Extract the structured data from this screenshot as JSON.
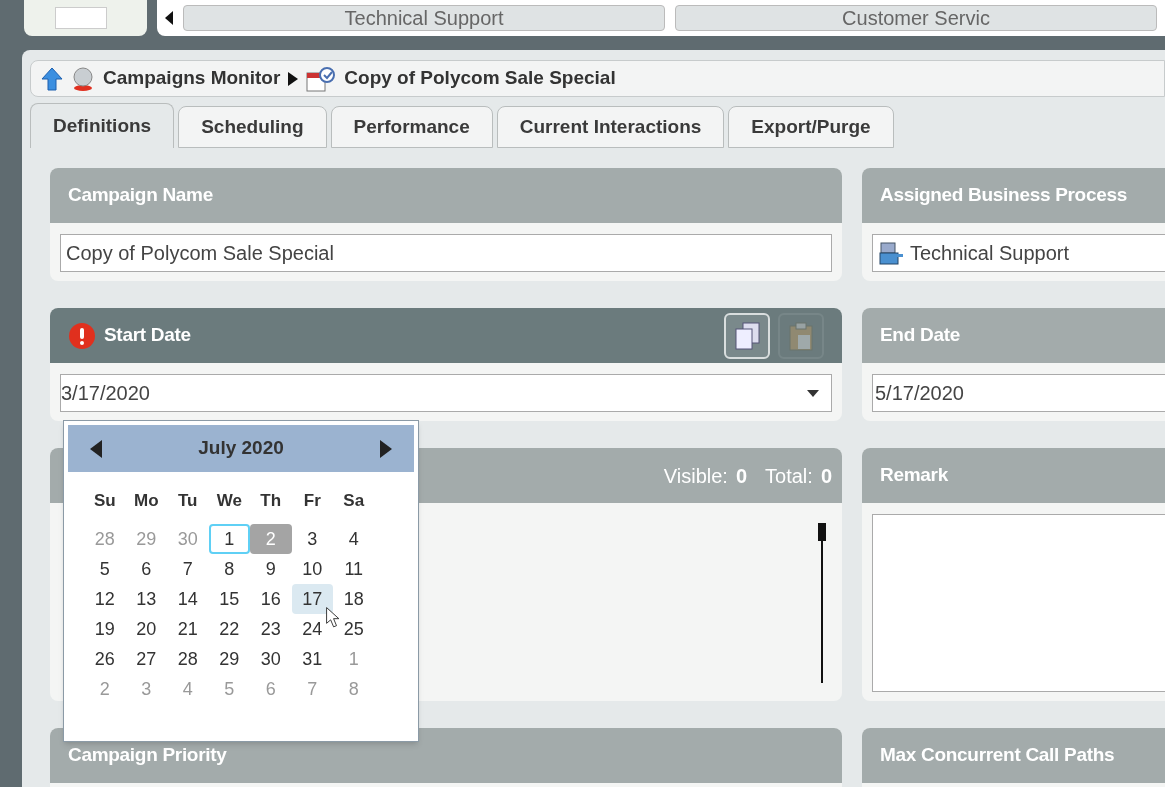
{
  "top_tabs": [
    "Technical Support",
    "Customer Servic"
  ],
  "breadcrumb": [
    "Campaigns Monitor",
    "Copy of Polycom Sale Special"
  ],
  "tabs": [
    {
      "label": "Definitions",
      "selected": true
    },
    {
      "label": "Scheduling",
      "selected": false
    },
    {
      "label": "Performance",
      "selected": false
    },
    {
      "label": "Current Interactions",
      "selected": false
    },
    {
      "label": "Export/Purge",
      "selected": false
    }
  ],
  "campaign_name": {
    "label": "Campaign Name",
    "value": "Copy of Polycom Sale Special"
  },
  "business_process": {
    "label": "Assigned Business Process",
    "value": "Technical Support"
  },
  "start_date": {
    "label": "Start Date",
    "value": "3/17/2020",
    "error": true,
    "paste_enabled": false
  },
  "end_date": {
    "label": "End Date",
    "value": "5/17/2020"
  },
  "list_panel": {
    "visible_label": "Visible:",
    "visible_count": "0",
    "total_label": "Total:",
    "total_count": "0"
  },
  "remark": {
    "label": "Remark"
  },
  "campaign_priority": {
    "label": "Campaign Priority"
  },
  "max_call_paths": {
    "label": "Max Concurrent Call Paths"
  },
  "calendar": {
    "month": "July 2020",
    "weekdays": [
      "Su",
      "Mo",
      "Tu",
      "We",
      "Th",
      "Fr",
      "Sa"
    ],
    "days": [
      {
        "day": "28",
        "in_month": false,
        "today": false,
        "selected": false,
        "hover": false
      },
      {
        "day": "29",
        "in_month": false,
        "today": false,
        "selected": false,
        "hover": false
      },
      {
        "day": "30",
        "in_month": false,
        "today": false,
        "selected": false,
        "hover": false
      },
      {
        "day": "1",
        "in_month": true,
        "today": true,
        "selected": false,
        "hover": false
      },
      {
        "day": "2",
        "in_month": true,
        "today": false,
        "selected": true,
        "hover": false
      },
      {
        "day": "3",
        "in_month": true,
        "today": false,
        "selected": false,
        "hover": false
      },
      {
        "day": "4",
        "in_month": true,
        "today": false,
        "selected": false,
        "hover": false
      },
      {
        "day": "5",
        "in_month": true,
        "today": false,
        "selected": false,
        "hover": false
      },
      {
        "day": "6",
        "in_month": true,
        "today": false,
        "selected": false,
        "hover": false
      },
      {
        "day": "7",
        "in_month": true,
        "today": false,
        "selected": false,
        "hover": false
      },
      {
        "day": "8",
        "in_month": true,
        "today": false,
        "selected": false,
        "hover": false
      },
      {
        "day": "9",
        "in_month": true,
        "today": false,
        "selected": false,
        "hover": false
      },
      {
        "day": "10",
        "in_month": true,
        "today": false,
        "selected": false,
        "hover": false
      },
      {
        "day": "11",
        "in_month": true,
        "today": false,
        "selected": false,
        "hover": false
      },
      {
        "day": "12",
        "in_month": true,
        "today": false,
        "selected": false,
        "hover": false
      },
      {
        "day": "13",
        "in_month": true,
        "today": false,
        "selected": false,
        "hover": false
      },
      {
        "day": "14",
        "in_month": true,
        "today": false,
        "selected": false,
        "hover": false
      },
      {
        "day": "15",
        "in_month": true,
        "today": false,
        "selected": false,
        "hover": false
      },
      {
        "day": "16",
        "in_month": true,
        "today": false,
        "selected": false,
        "hover": false
      },
      {
        "day": "17",
        "in_month": true,
        "today": false,
        "selected": false,
        "hover": true
      },
      {
        "day": "18",
        "in_month": true,
        "today": false,
        "selected": false,
        "hover": false
      },
      {
        "day": "19",
        "in_month": true,
        "today": false,
        "selected": false,
        "hover": false
      },
      {
        "day": "20",
        "in_month": true,
        "today": false,
        "selected": false,
        "hover": false
      },
      {
        "day": "21",
        "in_month": true,
        "today": false,
        "selected": false,
        "hover": false
      },
      {
        "day": "22",
        "in_month": true,
        "today": false,
        "selected": false,
        "hover": false
      },
      {
        "day": "23",
        "in_month": true,
        "today": false,
        "selected": false,
        "hover": false
      },
      {
        "day": "24",
        "in_month": true,
        "today": false,
        "selected": false,
        "hover": false
      },
      {
        "day": "25",
        "in_month": true,
        "today": false,
        "selected": false,
        "hover": false
      },
      {
        "day": "26",
        "in_month": true,
        "today": false,
        "selected": false,
        "hover": false
      },
      {
        "day": "27",
        "in_month": true,
        "today": false,
        "selected": false,
        "hover": false
      },
      {
        "day": "28",
        "in_month": true,
        "today": false,
        "selected": false,
        "hover": false
      },
      {
        "day": "29",
        "in_month": true,
        "today": false,
        "selected": false,
        "hover": false
      },
      {
        "day": "30",
        "in_month": true,
        "today": false,
        "selected": false,
        "hover": false
      },
      {
        "day": "31",
        "in_month": true,
        "today": false,
        "selected": false,
        "hover": false
      },
      {
        "day": "1",
        "in_month": false,
        "today": false,
        "selected": false,
        "hover": false
      },
      {
        "day": "2",
        "in_month": false,
        "today": false,
        "selected": false,
        "hover": false
      },
      {
        "day": "3",
        "in_month": false,
        "today": false,
        "selected": false,
        "hover": false
      },
      {
        "day": "4",
        "in_month": false,
        "today": false,
        "selected": false,
        "hover": false
      },
      {
        "day": "5",
        "in_month": false,
        "today": false,
        "selected": false,
        "hover": false
      },
      {
        "day": "6",
        "in_month": false,
        "today": false,
        "selected": false,
        "hover": false
      },
      {
        "day": "7",
        "in_month": false,
        "today": false,
        "selected": false,
        "hover": false
      },
      {
        "day": "8",
        "in_month": false,
        "today": false,
        "selected": false,
        "hover": false
      }
    ]
  }
}
